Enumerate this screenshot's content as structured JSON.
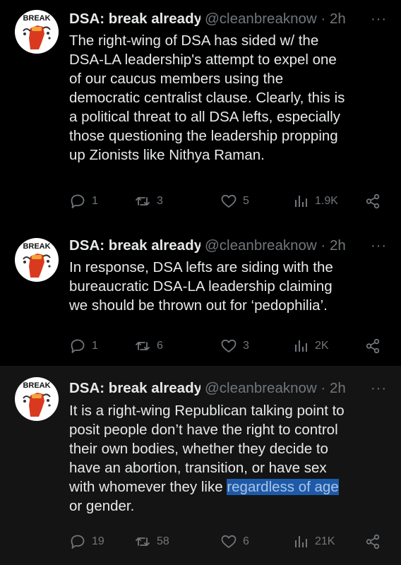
{
  "tweets": [
    {
      "name": "DSA: break already",
      "handle": "@cleanbreaknow",
      "sep": "·",
      "time": "2h",
      "more": "···",
      "body_lines": [
        "The right-wing of DSA has sided w/ the",
        "DSA-LA leadership's attempt to expel one",
        "of our caucus members using the",
        "democratic centralist clause. Clearly, this is",
        "a political threat to all DSA lefts, especially",
        "those questioning the leadership propping",
        "up Zionists like Nithya Raman."
      ],
      "replies": "1",
      "reposts": "3",
      "likes": "5",
      "views": "1.9K"
    },
    {
      "name": "DSA: break already",
      "handle": "@cleanbreaknow",
      "sep": "·",
      "time": "2h",
      "more": "···",
      "body_lines": [
        "In response, DSA lefts are siding with the",
        "bureaucratic DSA-LA leadership claiming",
        "we should be thrown out for ‘pedophilia’."
      ],
      "replies": "1",
      "reposts": "6",
      "likes": "3",
      "views": "2K"
    },
    {
      "name": "DSA: break already",
      "handle": "@cleanbreaknow",
      "sep": "·",
      "time": "2h",
      "more": "···",
      "body_lines": [
        "It is a right-wing Republican talking point to",
        "posit people don’t have the right to control",
        "their own bodies, whether they decide to",
        "have an abortion, transition, or have sex",
        "or gender."
      ],
      "line5_prefix": "with whomever they like ",
      "line5_highlight": "regardless of age",
      "replies": "19",
      "reposts": "58",
      "likes": "6",
      "views": "21K"
    }
  ],
  "avatar_text": "BREAK",
  "colors": {
    "background": "#000000",
    "selected_background": "#141414",
    "text": "#e7e9ea",
    "muted": "#71767b",
    "highlight": "#1e5aa8"
  }
}
